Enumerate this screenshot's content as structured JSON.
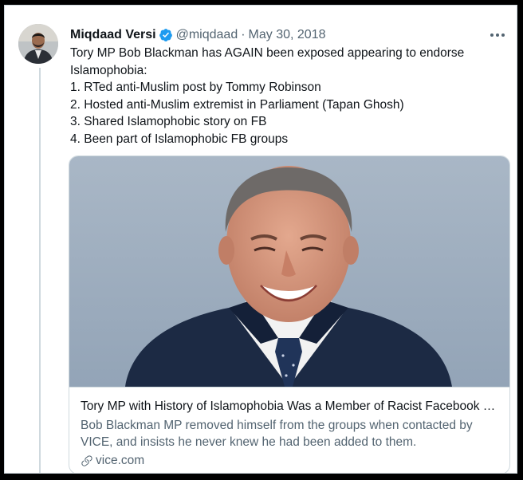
{
  "tweet": {
    "author_name": "Miqdaad Versi",
    "handle": "@miqdaad",
    "separator": "·",
    "date": "May 30, 2018",
    "more_label": "···",
    "text_lines": [
      "Tory MP Bob Blackman has AGAIN been exposed appearing to endorse",
      "Islamophobia:",
      "1. RTed anti-Muslim post by Tommy Robinson",
      "2. Hosted anti-Muslim extremist in Parliament (Tapan Ghosh)",
      "3. Shared Islamophobic story on FB",
      "4. Been part of Islamophobic FB groups"
    ]
  },
  "card": {
    "title": "Tory MP with History of Islamophobia Was a Member of Racist Facebook Groups",
    "description_lines": [
      "Bob Blackman MP removed himself from the groups when contacted by",
      "VICE, and insists he never knew he had been added to them."
    ],
    "domain": "vice.com"
  },
  "icons": {
    "verified": "verified-badge-icon",
    "more": "more-options-icon",
    "link": "link-icon"
  },
  "colors": {
    "verified_blue": "#1d9bf0",
    "secondary_text": "#536471",
    "primary_text": "#0f1419",
    "border": "#cfd9de"
  }
}
